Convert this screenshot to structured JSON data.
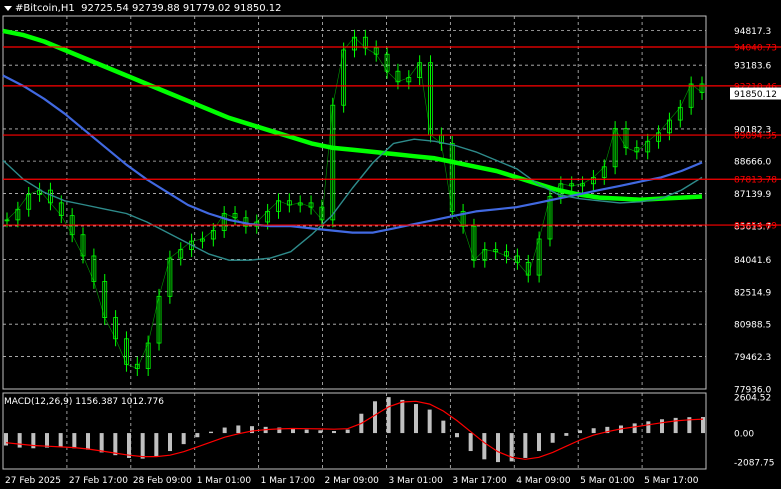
{
  "header": {
    "symbol": "#Bitcoin,H1",
    "ohlc": "92725.54 92739.88 91779.02 91850.12"
  },
  "colors": {
    "background": "#000000",
    "grid": "#c0c0c0",
    "candle": "#00ff00",
    "ma_slow": "#00ff00",
    "ma_mid": "#4169e1",
    "ma_fast": "#2e8b8b",
    "level_line": "#ff0000",
    "macd_hist": "#c0c0c0",
    "macd_signal": "#ff0000"
  },
  "chart_data": [
    {
      "type": "line",
      "title": "#Bitcoin,H1",
      "y_ticks": [
        94817.3,
        93183.6,
        91850.12,
        90182.3,
        88666.0,
        87139.9,
        85613.7,
        84041.6,
        82514.9,
        80988.5,
        79462.3,
        77936.0
      ],
      "ylim": [
        77936.0,
        95500.0
      ],
      "x_ticks": [
        "27 Feb 2025",
        "27 Feb 17:00",
        "28 Feb 09:00",
        "1 Mar 01:00",
        "1 Mar 17:00",
        "2 Mar 09:00",
        "3 Mar 01:00",
        "3 Mar 17:00",
        "4 Mar 09:00",
        "5 Mar 01:00",
        "5 Mar 17:00"
      ],
      "current_price": 91850.12,
      "levels": [
        94040.73,
        92210.46,
        89894.35,
        87813.78,
        85654.69
      ],
      "series": [
        {
          "name": "",
          "role": "price",
          "values": [
            85900,
            86400,
            87100,
            87300,
            86700,
            86100,
            85200,
            84200,
            83000,
            81300,
            80300,
            79100,
            78900,
            80100,
            82300,
            84100,
            84500,
            84900,
            85000,
            85400,
            86200,
            86000,
            85600,
            85800,
            86300,
            86800,
            86600,
            86700,
            86500,
            85900,
            91300,
            93900,
            94500,
            94000,
            93700,
            92900,
            92400,
            92600,
            93300,
            89900,
            89500,
            86300,
            85600,
            84000,
            84500,
            84400,
            84200,
            83900,
            83300,
            85000,
            87000,
            87600,
            87500,
            87600,
            87900,
            88400,
            90200,
            89300,
            89100,
            89600,
            90000,
            90600,
            91200,
            92300,
            91900
          ]
        },
        {
          "name": "",
          "role": "ma_slow",
          "values": [
            94800,
            94600,
            94300,
            93900,
            93500,
            93100,
            92700,
            92300,
            91900,
            91500,
            91100,
            90700,
            90400,
            90100,
            89800,
            89500,
            89300,
            89200,
            89100,
            89000,
            88900,
            88800,
            88600,
            88400,
            88200,
            87900,
            87600,
            87300,
            87100,
            86950,
            86900,
            86850,
            86900,
            86950,
            87000
          ]
        },
        {
          "name": "",
          "role": "ma_mid",
          "values": [
            92700,
            92200,
            91600,
            90900,
            90100,
            89300,
            88500,
            87800,
            87200,
            86600,
            86200,
            85900,
            85700,
            85600,
            85600,
            85500,
            85400,
            85300,
            85300,
            85500,
            85700,
            85900,
            86100,
            86300,
            86400,
            86500,
            86700,
            86900,
            87100,
            87300,
            87500,
            87700,
            87900,
            88200,
            88600
          ]
        },
        {
          "name": "",
          "role": "ma_fast",
          "values": [
            88700,
            87800,
            87200,
            86800,
            86600,
            86400,
            86200,
            85800,
            85300,
            84800,
            84300,
            84000,
            84000,
            84100,
            84400,
            85200,
            86100,
            87400,
            88600,
            89500,
            89700,
            89600,
            89400,
            89100,
            88700,
            88300,
            87600,
            87100,
            86900,
            86800,
            86700,
            86750,
            86900,
            87300,
            87900
          ]
        }
      ]
    },
    {
      "type": "bar",
      "title": "MACD(12,26,9) 1156.387 1012.776",
      "y_ticks": [
        2604.52,
        0.0,
        -2087.75
      ],
      "ylim": [
        -2600,
        2900
      ],
      "series": [
        {
          "name": "MACD",
          "values": [
            -900,
            -1050,
            -1100,
            -1050,
            -1000,
            -1100,
            -1200,
            -1400,
            -1600,
            -1800,
            -1850,
            -1700,
            -1300,
            -800,
            -300,
            100,
            400,
            550,
            500,
            450,
            400,
            350,
            250,
            200,
            150,
            250,
            1400,
            2300,
            2600,
            2400,
            2100,
            1700,
            900,
            -300,
            -1300,
            -1900,
            -2100,
            -2050,
            -1800,
            -1300,
            -700,
            -200,
            200,
            350,
            450,
            550,
            700,
            850,
            1000,
            1100,
            1150,
            1160
          ]
        },
        {
          "name": "Signal",
          "values": [
            -700,
            -800,
            -900,
            -950,
            -1000,
            -1050,
            -1150,
            -1300,
            -1450,
            -1600,
            -1700,
            -1700,
            -1600,
            -1350,
            -1000,
            -650,
            -300,
            -50,
            150,
            250,
            300,
            330,
            320,
            300,
            280,
            320,
            700,
            1300,
            1900,
            2250,
            2300,
            2100,
            1600,
            900,
            100,
            -700,
            -1350,
            -1750,
            -1900,
            -1750,
            -1400,
            -950,
            -500,
            -150,
            100,
            300,
            450,
            600,
            750,
            880,
            960,
            1010
          ]
        }
      ]
    }
  ]
}
